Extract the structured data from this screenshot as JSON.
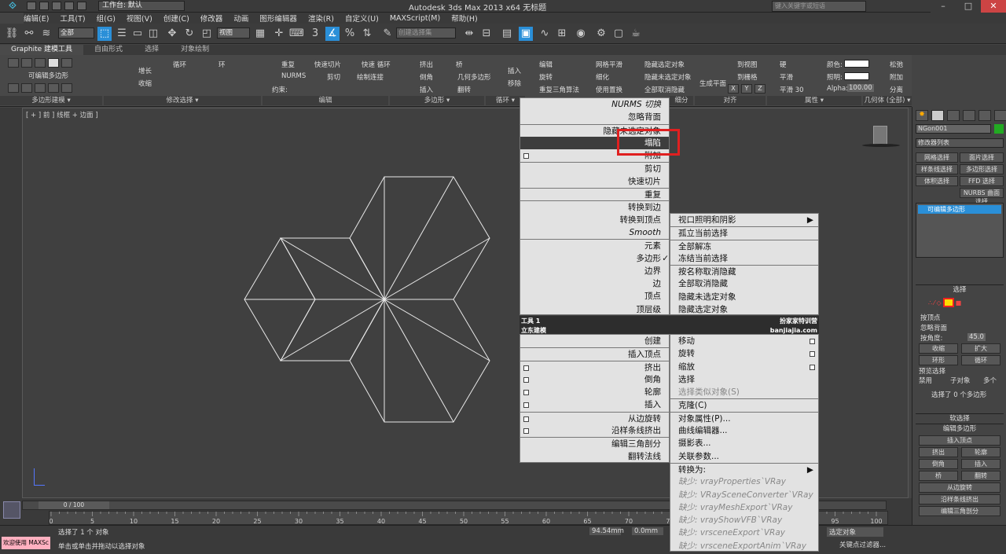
{
  "title": {
    "workspace": "工作台: 默认",
    "app_title": "Autodesk 3ds Max  2013 x64    无标题",
    "search_placeholder": "键入关键字或短语"
  },
  "menu": [
    "编辑(E)",
    "工具(T)",
    "组(G)",
    "视图(V)",
    "创建(C)",
    "修改器",
    "动画",
    "图形编辑器",
    "渲染(R)",
    "自定义(U)",
    "MAXScript(M)",
    "帮助(H)"
  ],
  "toolbar": {
    "selection_filter": "全部",
    "ref_coord": "视图",
    "named_sel": "创建选择集",
    "num3": "3",
    "pct": "%",
    "num_n": "n"
  },
  "ribbon_tabs": [
    "Graphite 建模工具",
    "自由形式",
    "选择",
    "对象绘制"
  ],
  "ribbon": {
    "polymodel": "可编辑多边形",
    "grow": "增长",
    "shrink": "收缩",
    "loop": "循环",
    "ring": "环",
    "repeat": "重复",
    "nurms": "NURMS",
    "constraint": "约束:",
    "quickslice": "快速切片",
    "cut": "剪切",
    "quickloop": "快速 循环",
    "drawconnect": "绘制连接",
    "extrude": "挤出",
    "bevel": "倒角",
    "insert": "插入",
    "bridge": "桥",
    "geopoly": "几何多边形",
    "flip": "翻转",
    "insert2": "插入",
    "remove": "移除",
    "edit": "编辑",
    "rotate": "旋转",
    "retriangulate": "重复三角算法",
    "meshsmooth": "网格平滑",
    "refine": "细化",
    "usedisplace": "使用置换",
    "hideunsel": "隐藏选定对象",
    "hideunsel2": "隐藏未选定对象",
    "unhideall": "全部取消隐藏",
    "genplane": "生成平面",
    "toview": "到视图",
    "togrid": "到栅格",
    "hard": "硬",
    "smooth": "平滑",
    "smooth30": "平滑 30",
    "color": "颜色:",
    "illum": "照明:",
    "alpha": "Alpha:",
    "alpha_val": "100.00",
    "copy": "松弛",
    "create": "创建",
    "attach": "附加",
    "sep": "分离",
    "collapse": "塌陷",
    "x": "X",
    "y": "Y",
    "z": "Z"
  },
  "ribbon_sections": [
    "多边形建模 ▾",
    "修改选择 ▾",
    "编辑",
    "多边形 ▾",
    "循环 ▾",
    "细分",
    "三角剖分",
    "对齐",
    "属性 ▾",
    "几何体 (全部) ▾"
  ],
  "viewport": {
    "label": "[ + ] 前 ] 线框 + 边面 ]"
  },
  "cmdpanel": {
    "objname": "NGon001",
    "modlist": "修改器列表",
    "btns": [
      "网格选择",
      "面片选择",
      "样条线选择",
      "多边形选择",
      "体积选择",
      "FFD 选择",
      "NURBS 曲面选择"
    ],
    "stack_item": "可编辑多边形",
    "rollout_sel": "选择",
    "byvertex": "按顶点",
    "ignoreback": "忽略背面",
    "byangle": "按角度:",
    "angle": "45.0",
    "shrinkb": "收缩",
    "growb": "扩大",
    "ringb": "环形",
    "loopb": "循环",
    "preview": "预览选择",
    "off": "禁用",
    "subobj": "子对象",
    "multi": "多个",
    "selinfo": "选择了 0 个多边形",
    "softsel": "软选择",
    "editpoly": "编辑多边形",
    "insvert": "插入顶点",
    "extrudeb": "挤出",
    "outline": "轮廓",
    "bevelb": "倒角",
    "insertb": "插入",
    "bridgeb": "桥",
    "flipb": "翻转",
    "hinge": "从边旋转",
    "spline": "沿样条线挤出",
    "edittri": "编辑三角剖分"
  },
  "timeline": {
    "frame": "0 / 100",
    "ticks": [
      "0",
      "5",
      "10",
      "15",
      "20",
      "25",
      "30",
      "35",
      "40",
      "45",
      "50",
      "55",
      "60",
      "65",
      "70",
      "75",
      "80",
      "85",
      "90",
      "95",
      "100"
    ]
  },
  "status": {
    "welcome": "欢迎使用 MAXSc",
    "selected": "选择了 1 个 对象",
    "hint": "单击或单击并拖动以选择对象",
    "x": "94.54mm",
    "y": "0.0mm",
    "autokey": "选定对象",
    "keyfilter": "关键点过滤器..."
  },
  "quad_left_top": [
    {
      "t": "NURMS 切换",
      "i": true
    },
    {
      "t": "忽略背面"
    },
    {
      "t": "隐藏未选定对象",
      "sep": true
    },
    {
      "t": "塌陷",
      "hl": true
    },
    {
      "t": "附加",
      "box": true
    },
    {
      "t": "剪切",
      "sep": true
    },
    {
      "t": "快速切片"
    },
    {
      "t": "重复",
      "sep": true
    },
    {
      "t": "转换到边",
      "sep": true
    },
    {
      "t": "转换到顶点"
    },
    {
      "t": "Smooth",
      "i": true
    },
    {
      "t": "元素",
      "sep": true
    },
    {
      "t": "多边形",
      "chk": true
    },
    {
      "t": "边界"
    },
    {
      "t": "边"
    },
    {
      "t": "顶点"
    },
    {
      "t": "顶层级"
    }
  ],
  "quad_right_top": [
    {
      "t": "视口照明和阴影",
      "arr": true
    },
    {
      "t": "孤立当前选择",
      "sep": true
    },
    {
      "t": "全部解冻",
      "sep": true
    },
    {
      "t": "冻结当前选择"
    },
    {
      "t": "按名称取消隐藏",
      "sep": true
    },
    {
      "t": "全部取消隐藏"
    },
    {
      "t": "隐藏未选定对象"
    },
    {
      "t": "隐藏选定对象"
    }
  ],
  "quad_headers": {
    "tools1": "工具 1",
    "lidong": "立东建模",
    "display": "扮家家特训营",
    "site": "banjiajia.com"
  },
  "quad_left_bottom": [
    {
      "t": "创建"
    },
    {
      "t": "插入顶点",
      "sep": true
    },
    {
      "t": "挤出",
      "box": true,
      "sep": true
    },
    {
      "t": "倒角",
      "box": true
    },
    {
      "t": "轮廓",
      "box": true
    },
    {
      "t": "插入",
      "box": true
    },
    {
      "t": "从边旋转",
      "box": true,
      "sep": true
    },
    {
      "t": "沿样条线挤出",
      "box": true
    },
    {
      "t": "编辑三角剖分",
      "sep": true
    },
    {
      "t": "翻转法线"
    }
  ],
  "quad_right_bottom": [
    {
      "t": "移动",
      "rbox": true
    },
    {
      "t": "旋转",
      "rbox": true
    },
    {
      "t": "缩放",
      "rbox": true
    },
    {
      "t": "选择"
    },
    {
      "t": "选择类似对象(S)",
      "dim": true
    },
    {
      "t": "克隆(C)",
      "sep": true
    },
    {
      "t": "对象属性(P)...",
      "sep": true
    },
    {
      "t": "曲线编辑器..."
    },
    {
      "t": "摄影表..."
    },
    {
      "t": "关联参数..."
    },
    {
      "t": "转换为:",
      "arr": true,
      "sep": true
    },
    {
      "t": "缺少: vrayProperties`VRay",
      "dim": true,
      "i": true
    },
    {
      "t": "缺少: VRaySceneConverter`VRay",
      "dim": true,
      "i": true
    },
    {
      "t": "缺少: vrayMeshExport`VRay",
      "dim": true,
      "i": true
    },
    {
      "t": "缺少: vrayShowVFB`VRay",
      "dim": true,
      "i": true
    },
    {
      "t": "缺少: vrsceneExport`VRay",
      "dim": true,
      "i": true
    },
    {
      "t": "缺少: vrsceneExportAnim`VRay",
      "dim": true,
      "i": true
    }
  ],
  "colors": {
    "highlight_box": "#e02020",
    "accent": "#2a8fd8"
  }
}
